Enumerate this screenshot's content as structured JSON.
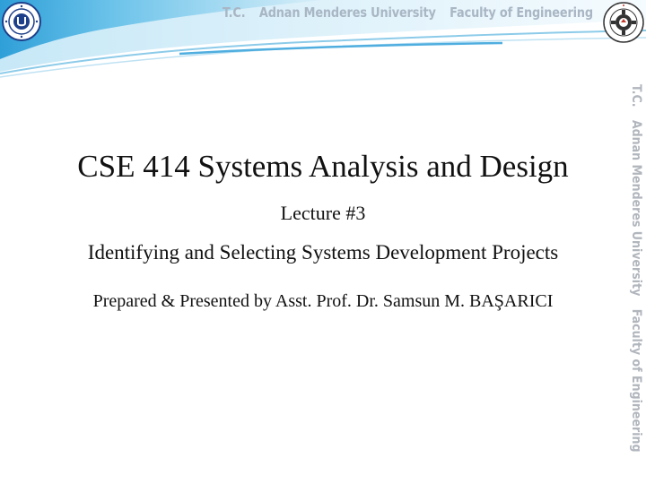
{
  "header": {
    "institution_prefix": "T.C.",
    "university": "Adnan Menderes University",
    "faculty": "Faculty of Engineering"
  },
  "side": {
    "institution_prefix": "T.C.",
    "university": "Adnan Menderes University",
    "faculty": "Faculty of Engineering"
  },
  "logos": {
    "left_icon": "university-seal-icon",
    "right_icon": "faculty-gear-seal-icon"
  },
  "slide": {
    "title": "CSE 414 Systems Analysis and Design",
    "lecture": "Lecture #3",
    "subtitle": "Identifying and Selecting Systems Development Projects",
    "presenter": "Prepared & Presented by Asst. Prof. Dr. Samsun M. BAŞARICI"
  },
  "colors": {
    "banner_light": "#dff2fb",
    "banner_blue": "#3aa6dc",
    "header_text": "#a9b6c4",
    "side_text": "#b1b6bd"
  }
}
